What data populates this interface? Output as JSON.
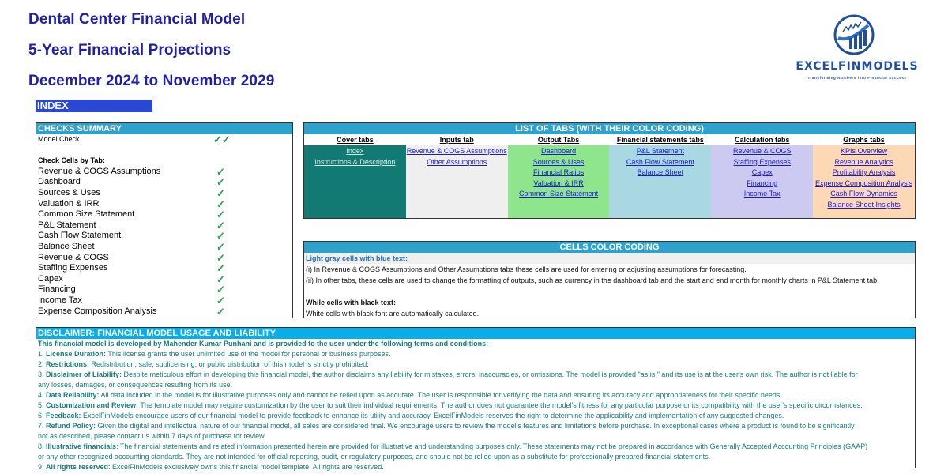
{
  "header": {
    "title_line1": "Dental Center Financial Model",
    "title_line2": "5-Year Financial Projections",
    "title_line3": "December 2024 to November 2029",
    "index_label": "INDEX"
  },
  "logo": {
    "name": "EXCELFINMODELS",
    "tagline": "Transforming Numbers into Financial Success",
    "icon": "growth-chart-circle-icon"
  },
  "colors": {
    "title": "#1f1fa8",
    "index_bar": "#2b47d6",
    "section_header": "#2ea2cd",
    "disclaimer_header": "#09aee8",
    "check_mark": "#2e9e4e",
    "cover_tabs": "#137a73",
    "inputs_tabs": "#efefef",
    "output_tabs": "#8ee58b",
    "financial_statements_tabs": "#a9d7e2",
    "calculation_tabs": "#cdcaf2",
    "graphs_tabs": "#fcd9b4",
    "disclaimer_text": "#127d7d"
  },
  "checks": {
    "header": "CHECKS  SUMMARY",
    "model_check_label": "Model Check",
    "model_check_mark": "✓✓",
    "by_tab_label": "Check Cells by Tab:",
    "items": [
      {
        "label": "Revenue & COGS Assumptions",
        "mark": "✓"
      },
      {
        "label": "Dashboard",
        "mark": "✓"
      },
      {
        "label": "Sources & Uses",
        "mark": "✓"
      },
      {
        "label": "Valuation & IRR",
        "mark": "✓"
      },
      {
        "label": "Common Size Statement",
        "mark": "✓"
      },
      {
        "label": "P&L Statement",
        "mark": "✓"
      },
      {
        "label": "Cash Flow Statement",
        "mark": "✓"
      },
      {
        "label": "Balance Sheet",
        "mark": "✓"
      },
      {
        "label": "Revenue & COGS",
        "mark": "✓"
      },
      {
        "label": "Staffing Expenses",
        "mark": "✓"
      },
      {
        "label": "Capex",
        "mark": "✓"
      },
      {
        "label": "Financing",
        "mark": "✓"
      },
      {
        "label": "Income Tax",
        "mark": "✓"
      },
      {
        "label": "Expense Composition Analysis",
        "mark": "✓"
      }
    ]
  },
  "tabs_list": {
    "header": "LIST OF TABS (WITH THEIR COLOR CODING)",
    "columns": [
      {
        "title": "Cover tabs",
        "links": [
          "Index",
          "Instructions & Description"
        ]
      },
      {
        "title": "Inputs tab",
        "links": [
          "Revenue & COGS Assumptions",
          "Other Assumptions"
        ]
      },
      {
        "title": "Output Tabs",
        "links": [
          "Dashboard",
          "Sources & Uses",
          "Financial Ratios ",
          "Valuation & IRR",
          "Common Size Statement"
        ]
      },
      {
        "title": "Financial statements tabs",
        "links": [
          "P&L Statement",
          "Cash Flow Statement",
          "Balance Sheet"
        ]
      },
      {
        "title": "Calculation tabs",
        "links": [
          "Revenue & COGS",
          "Staffing Expenses",
          "Capex ",
          "Financing",
          "Income Tax"
        ]
      },
      {
        "title": "Graphs tabs",
        "links": [
          "KPIs Overview",
          "Revenue Analytics",
          "Profitability Analysis",
          "Expense Composition Analysis",
          "Cash Flow Dynamics",
          "Balance Sheet Insights"
        ]
      }
    ]
  },
  "coding": {
    "header": "CELLS COLOR CODING",
    "gray_title": "Light gray cells with blue text:",
    "gray_line1": "(i) In Revenue & COGS Assumptions and Other Assumptions tabs these cells are used for entering or adjusting assumptions for forecasting.",
    "gray_line2": "(ii) In other tabs, these cells are used to change the formatting of outputs, such as currency in the dashboard tab and the start and end month for monthly charts in P&L Statement tab.",
    "white_title": "While cells with black text:",
    "white_line1": "White cells with black font are automatically calculated."
  },
  "disclaimer": {
    "header": "DISCLAIMER: FINANCIAL MODEL USAGE AND LIABILITY",
    "intro": "This financial model  is developed by Mahender Kumar Punhani and is provided to the user under the following terms and conditions:",
    "lines": [
      {
        "prefix": "1. ",
        "term": "License Duration:",
        "text": " This license grants the user unlimited use of the model for personal or business purposes."
      },
      {
        "prefix": "2. ",
        "term": "Restrictions:",
        "text": " Redistribution, sale, sublicensing, or public distribution of this model is strictly prohibited."
      },
      {
        "prefix": "3. ",
        "term": "Disclaimer of Liability:",
        "text": " Despite meticulous effort in developing this financial model, the author disclaims any liability for mistakes, errors, inaccuracies, or omissions. The model is provided \"as is,\" and its use is at the user's own risk. The author is  not liable for"
      },
      {
        "prefix": "",
        "term": "",
        "text": "any  losses, damages, or consequences resulting from its use."
      },
      {
        "prefix": "4. ",
        "term": "Data Reliability:",
        "text": " All data included in the model is for illustrative purposes only and cannot be relied upon as accurate. The user is  responsible for verifying the data and ensuring its accuracy and appropriateness for their specific needs."
      },
      {
        "prefix": "5. ",
        "term": "Customization and Review:",
        "text": " The template model may require customization by the user to suit their individual requirements. The author does not guarantee the model's fitness for any  particular purpose or its compatibility with the user's specific circumstances."
      },
      {
        "prefix": "6. ",
        "term": "Feedback:",
        "text": " ExcelFinModels encourage users of our financial model to provide feedback to enhance its utility and accuracy. ExcelFinModels reserves the right to determine the applicability and implementation of any suggested changes."
      },
      {
        "prefix": "7. ",
        "term": "Refund Policy:",
        "text": " Given the digital and intellectual nature of our financial model, all sales are considered final. We encourage users to review the model's features and limitations before purchase. In exceptional cases where a product is found to be  significantly"
      },
      {
        "prefix": "",
        "term": "",
        "text": "not as described, please contact us within 7 days of purchase for review."
      },
      {
        "prefix": "8. ",
        "term": "Illustrative financials",
        "text": ": The financial statements and related information presented herein are provided for illustrative and understanding purposes only. These statements may not be prepared in accordance with Generally Accepted Accounting Principles (GAAP)"
      },
      {
        "prefix": "",
        "term": "",
        "text": "or any other  recognized accounting standards. They are not intended for official reporting, audit, or regulatory purposes, and should not be relied upon as a substitute for professionally prepared financial statements."
      },
      {
        "prefix": "9. ",
        "term": "All rights reserved",
        "text": ": ExcelFinModels exclusively owns this financial model template. All rights are reserved."
      }
    ]
  }
}
